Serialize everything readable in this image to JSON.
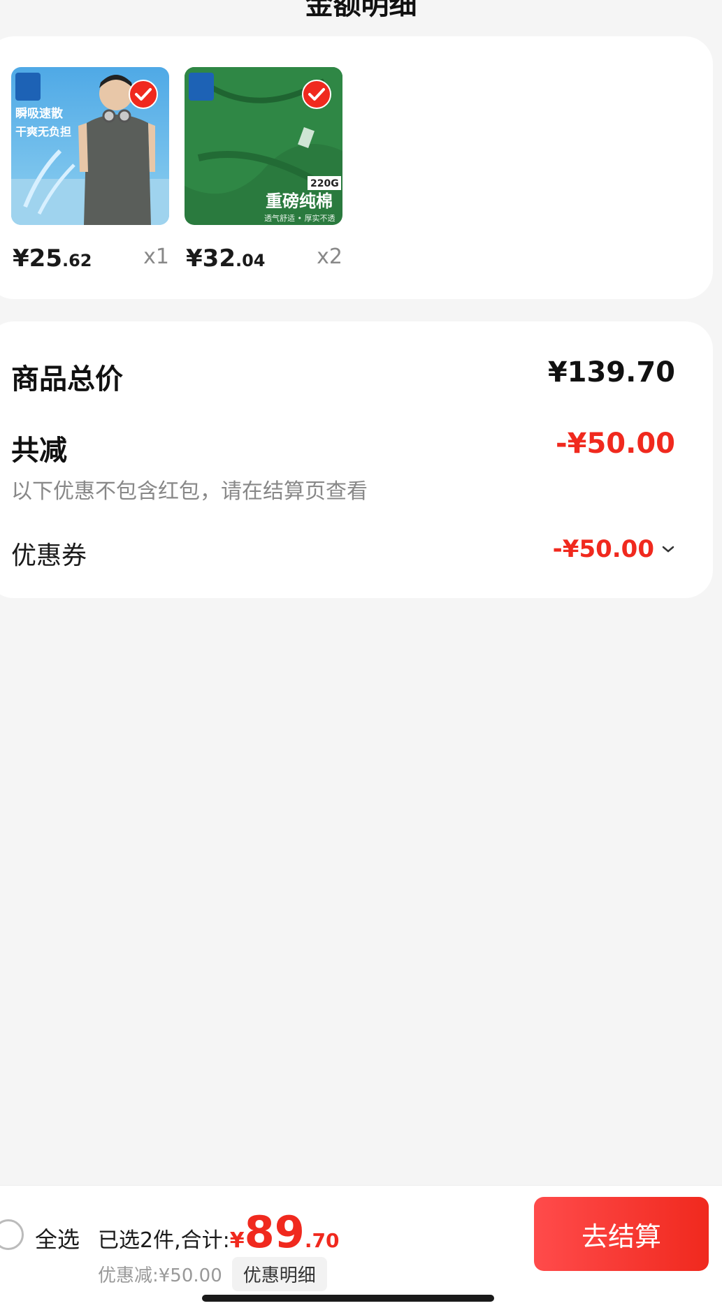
{
  "header": {
    "title": "金额明细"
  },
  "products": [
    {
      "price_int": "¥25",
      "price_dec": ".62",
      "qty": "x1",
      "banner_line1": "瞬吸速散",
      "banner_line2": "干爽无负担",
      "selected": true
    },
    {
      "price_int": "¥32",
      "price_dec": ".04",
      "qty": "x2",
      "tag": "220G",
      "banner_line1": "重磅纯棉",
      "banner_line2": "透气舒适 • 厚实不透",
      "selected": true
    }
  ],
  "summary": {
    "total_label": "商品总价",
    "total_value": "¥139.70",
    "discount_label": "共减",
    "discount_value": "-¥50.00",
    "discount_note": "以下优惠不包含红包，请在结算页查看",
    "coupon_label": "优惠券",
    "coupon_value": "-¥50.00"
  },
  "bottom_bar": {
    "select_all_label": "全选",
    "selected_text": "已选2件,合计:",
    "currency": "¥",
    "total_int": "89",
    "total_dec": ".70",
    "saved_text": "优惠减:¥50.00",
    "detail_button": "优惠明细",
    "checkout_button": "去结算"
  },
  "colors": {
    "accent_red": "#f0291e",
    "background": "#f5f5f5"
  }
}
